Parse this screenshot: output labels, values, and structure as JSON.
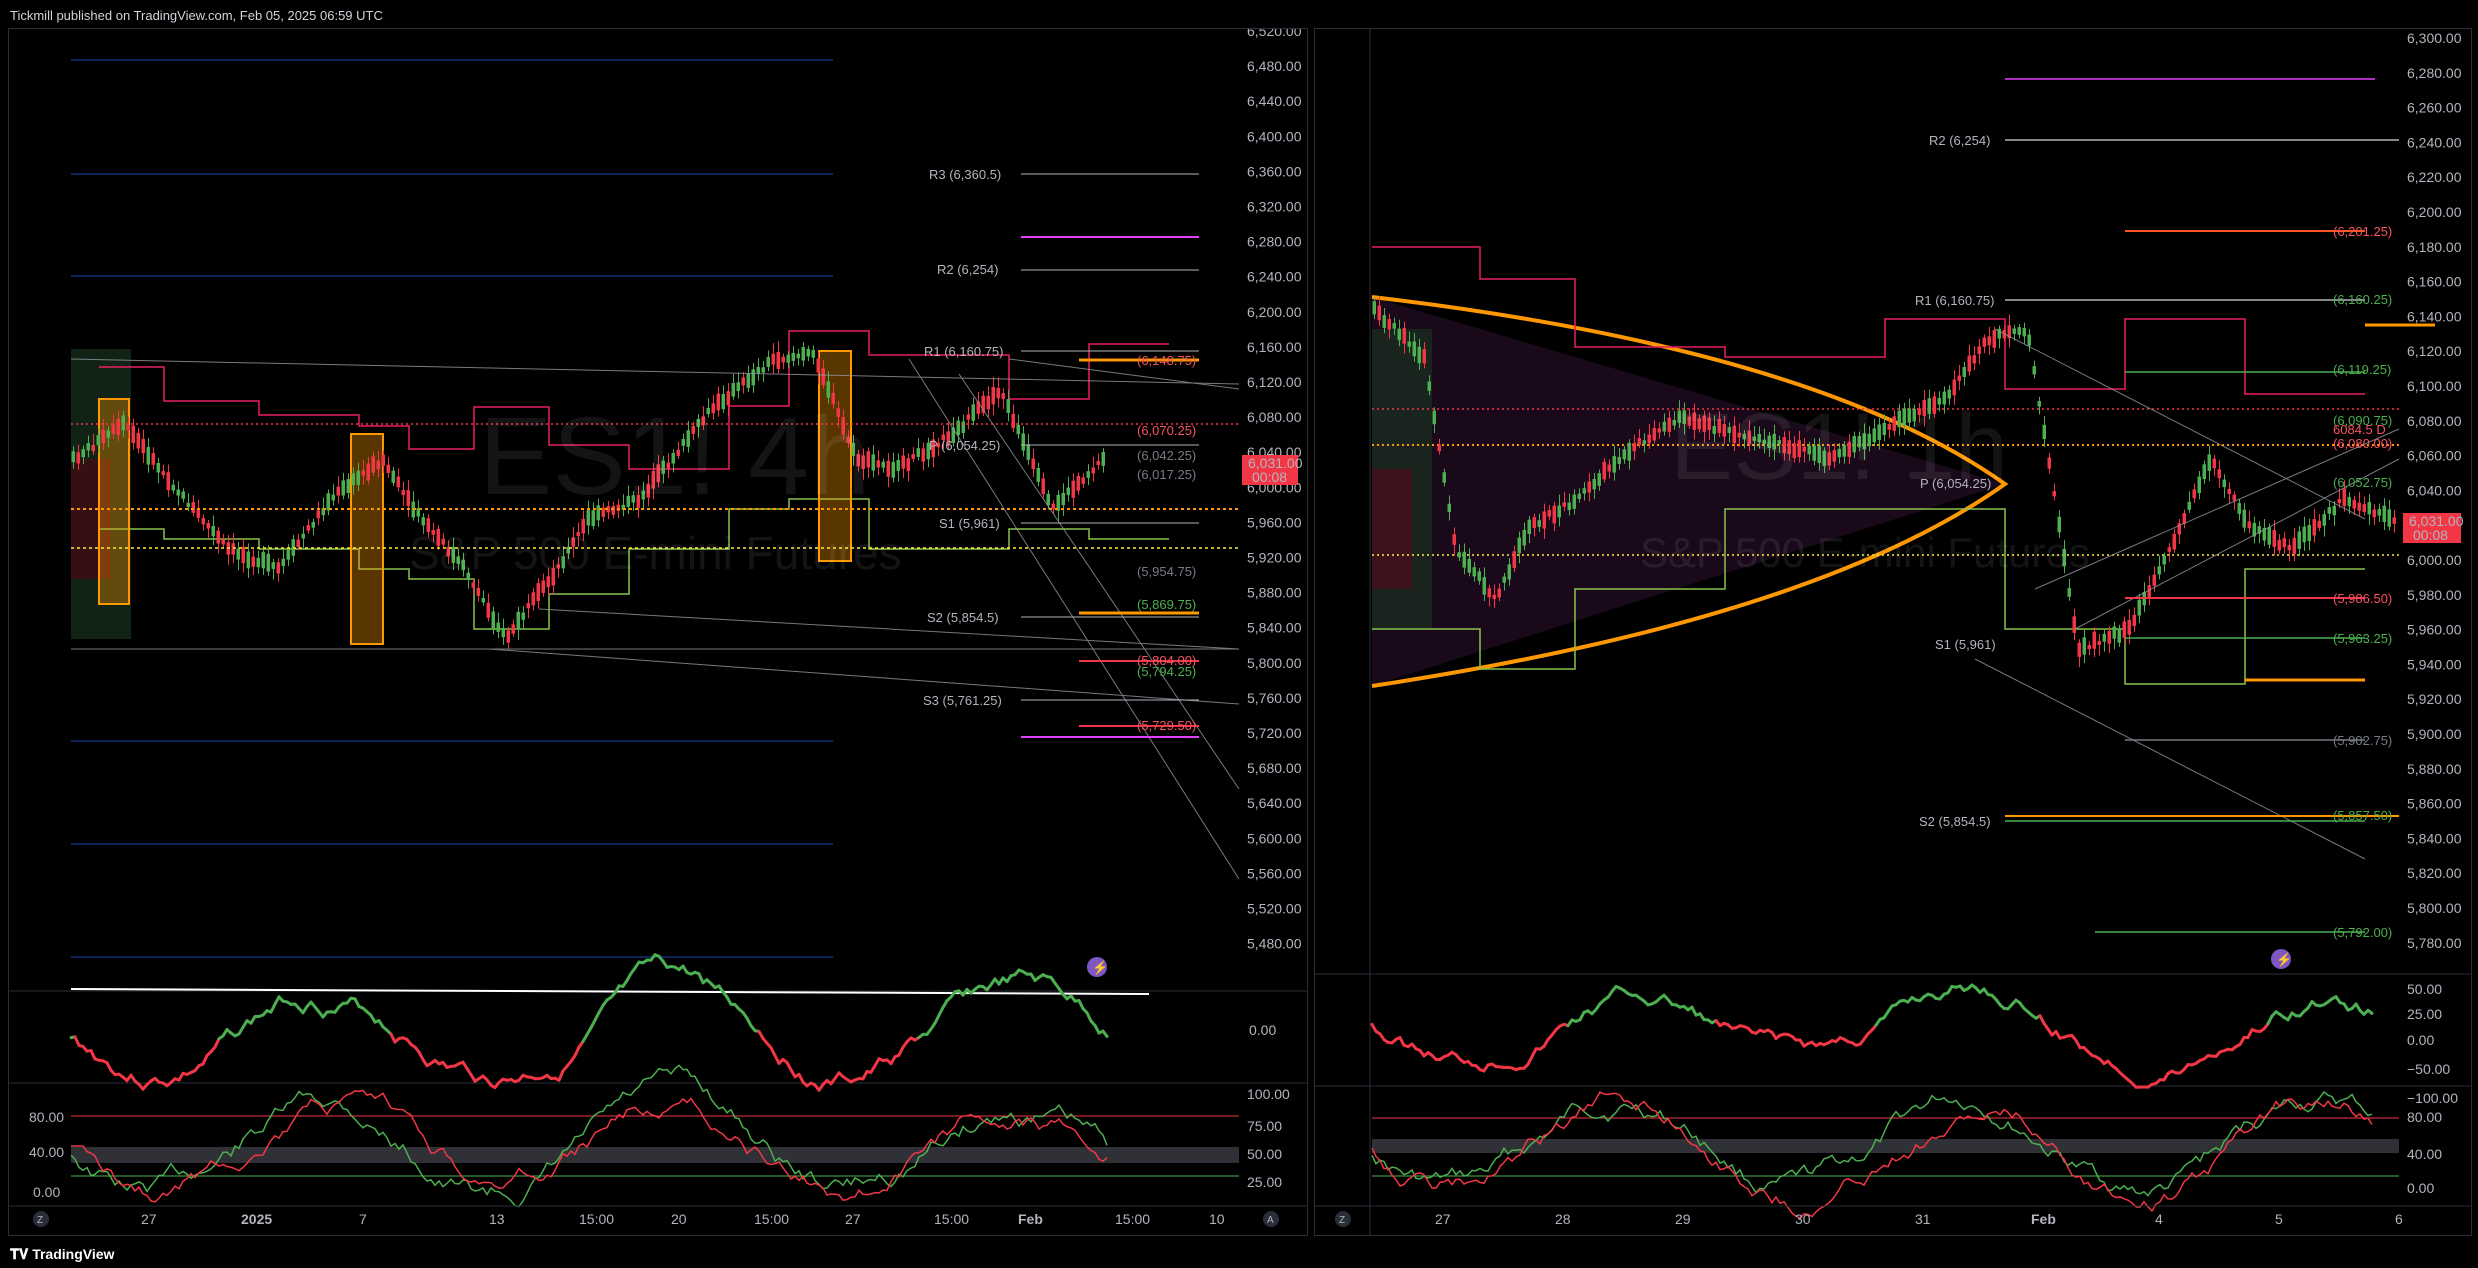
{
  "header": {
    "published": "Tickmill published on TradingView.com, Feb 05, 2025 06:59 UTC"
  },
  "footer": {
    "brand": "TradingView",
    "logo_icon": "tradingview-logo-icon"
  },
  "left": {
    "watermark_symbol": "ES1! 4h",
    "watermark_name": "S&P 500 E-mini Futures",
    "price_axis": [
      "6,520.00",
      "6,480.00",
      "6,440.00",
      "6,400.00",
      "6,360.00",
      "6,320.00",
      "6,280.00",
      "6,240.00",
      "6,200.00",
      "6,160.00",
      "6,120.00",
      "6,080.00",
      "6,040.00",
      "6,000.00",
      "5,960.00",
      "5,920.00",
      "5,880.00",
      "5,840.00",
      "5,800.00",
      "5,760.00",
      "5,720.00",
      "5,680.00",
      "5,640.00",
      "5,600.00",
      "5,560.00",
      "5,520.00",
      "5,480.00"
    ],
    "current_price": "6,031.00",
    "countdown": "00:08",
    "pivots": [
      "R3 (6,360.5)",
      "R2 (6,254)",
      "R1 (6,160.75)",
      "P (6,054.25)",
      "S1 (5,961)",
      "S2 (5,854.5)",
      "S3 (5,761.25)"
    ],
    "levels": [
      {
        "text": "(6,148.75)",
        "color": "#f7525f"
      },
      {
        "text": "(6,070.25)",
        "color": "#f7525f"
      },
      {
        "text": "(6,042.25)",
        "color": "#787b86"
      },
      {
        "text": "(6,017.25)",
        "color": "#787b86"
      },
      {
        "text": "(5,954.75)",
        "color": "#787b86"
      },
      {
        "text": "(5,869.75)",
        "color": "#4caf50"
      },
      {
        "text": "(5,804.00)",
        "color": "#f7525f"
      },
      {
        "text": "(5,794.25)",
        "color": "#4caf50"
      },
      {
        "text": "(5,729.50)",
        "color": "#f7525f"
      }
    ],
    "time_axis": [
      "27",
      "2025",
      "7",
      "13",
      "15:00",
      "20",
      "15:00",
      "27",
      "15:00",
      "Feb",
      "15:00",
      "10"
    ],
    "osc1_axis": [
      "0.00"
    ],
    "osc2_axis": [
      "100.00",
      "80.00",
      "75.00",
      "50.00",
      "40.00",
      "25.00",
      "0.00"
    ],
    "z_button": "Z",
    "a_button": "A"
  },
  "right": {
    "watermark_symbol": "ES1! 1h",
    "watermark_name": "S&P 500 E-mini Futures",
    "price_axis": [
      "6,300.00",
      "6,280.00",
      "6,260.00",
      "6,240.00",
      "6,220.00",
      "6,200.00",
      "6,180.00",
      "6,160.00",
      "6,140.00",
      "6,120.00",
      "6,100.00",
      "6,080.00",
      "6,060.00",
      "6,040.00",
      "6,020.00",
      "6,000.00",
      "5,980.00",
      "5,960.00",
      "5,940.00",
      "5,920.00",
      "5,900.00",
      "5,880.00",
      "5,860.00",
      "5,840.00",
      "5,820.00",
      "5,800.00",
      "5,780.00"
    ],
    "current_price": "6,031.00",
    "countdown": "00:08",
    "pivots": [
      "R2 (6,254)",
      "R1 (6,160.75)",
      "P (6,054.25)",
      "S1 (5,961)",
      "S2 (5,854.5)"
    ],
    "levels": [
      {
        "text": "(6,201.25)",
        "color": "#f7525f"
      },
      {
        "text": "(6,160.25)",
        "color": "#4caf50"
      },
      {
        "text": "(6,119.25)",
        "color": "#4caf50"
      },
      {
        "text": "(6,090.75)",
        "color": "#4caf50"
      },
      {
        "text": "6084.5 D",
        "color": "#f7525f"
      },
      {
        "text": "(6,080.00)",
        "color": "#f7525f"
      },
      {
        "text": "(6,052.75)",
        "color": "#4caf50"
      },
      {
        "text": "(5,986.50)",
        "color": "#f7525f"
      },
      {
        "text": "(5,963.25)",
        "color": "#4caf50"
      },
      {
        "text": "(5,902.75)",
        "color": "#787b86"
      },
      {
        "text": "(5,857.50)",
        "color": "#4caf50"
      },
      {
        "text": "(5,792.00)",
        "color": "#4caf50"
      }
    ],
    "time_axis": [
      "27",
      "28",
      "29",
      "30",
      "31",
      "Feb",
      "4",
      "5",
      "6"
    ],
    "osc1_axis": [
      "50.00",
      "25.00",
      "0.00",
      "−50.00",
      "−100.00"
    ],
    "osc2_axis": [
      "80.00",
      "40.00",
      "0.00"
    ],
    "z_button": "Z"
  },
  "colors": {
    "bull": "#4caf50",
    "bear": "#f23645",
    "pivot_orange": "#ff9800",
    "pink": "#e91e63",
    "blue_grid": "#2962ff",
    "price_badge": "#f23645"
  }
}
